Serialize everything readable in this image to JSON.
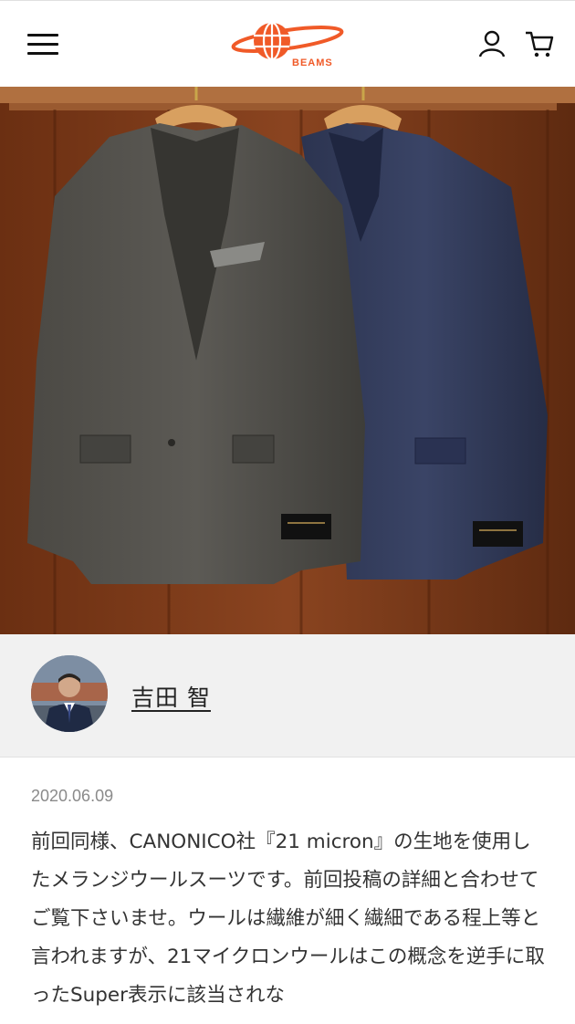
{
  "header": {
    "menu_icon": "hamburger-menu-icon",
    "logo_text": "BEAMS",
    "account_icon": "user-icon",
    "cart_icon": "cart-icon",
    "brand_color": "#f05a28"
  },
  "author": {
    "name": "吉田 智"
  },
  "post": {
    "date": "2020.06.09",
    "body": "前回同様、CANONICO社『21 micron』の生地を使用したメランジウールスーツです。前回投稿の詳細と合わせてご覧下さいませ。ウールは繊維が細く繊細である程上等と言われますが、21マイクロンウールはこの概念を逆手に取ったSuper表示に該当されな"
  }
}
